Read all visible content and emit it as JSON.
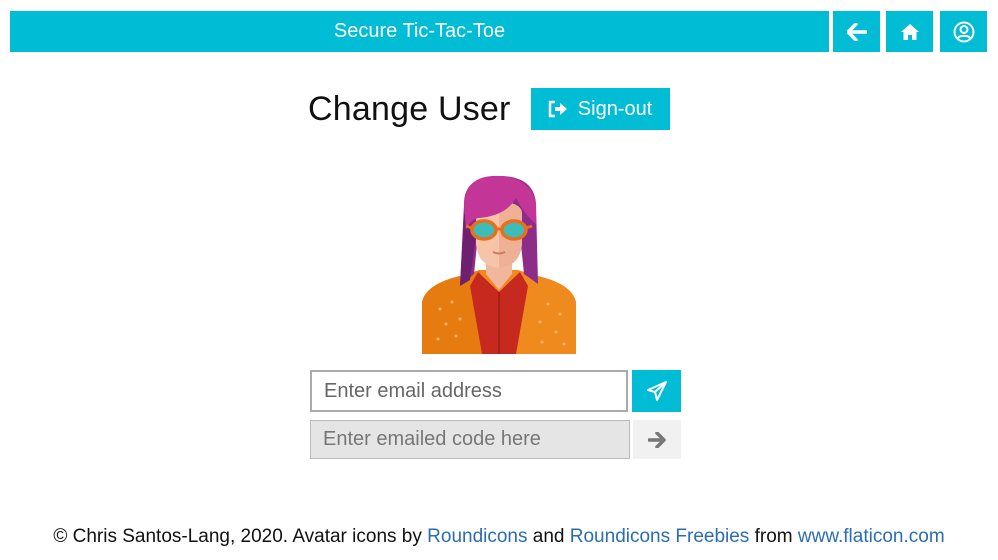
{
  "header": {
    "title": "Secure Tic-Tac-Toe",
    "nav": [
      {
        "icon": "arrow-left-icon"
      },
      {
        "icon": "home-icon"
      },
      {
        "icon": "user-circle-icon"
      }
    ]
  },
  "main": {
    "heading": "Change User",
    "signout_label": "Sign-out",
    "signout_icon": "sign-out-icon",
    "avatar_icon": "female-avatar-icon",
    "email_placeholder": "Enter email address",
    "send_icon": "paper-plane-icon",
    "code_placeholder": "Enter emailed code here",
    "submit_icon": "arrow-right-icon"
  },
  "footer": {
    "prefix": "© Chris Santos-Lang, 2020. Avatar icons by ",
    "link1": "Roundicons",
    "and": " and ",
    "link2": "Roundicons Freebies",
    "from": " from ",
    "link3": "www.flaticon.com"
  },
  "colors": {
    "accent": "#00bcd4",
    "link": "#2a6db5"
  }
}
